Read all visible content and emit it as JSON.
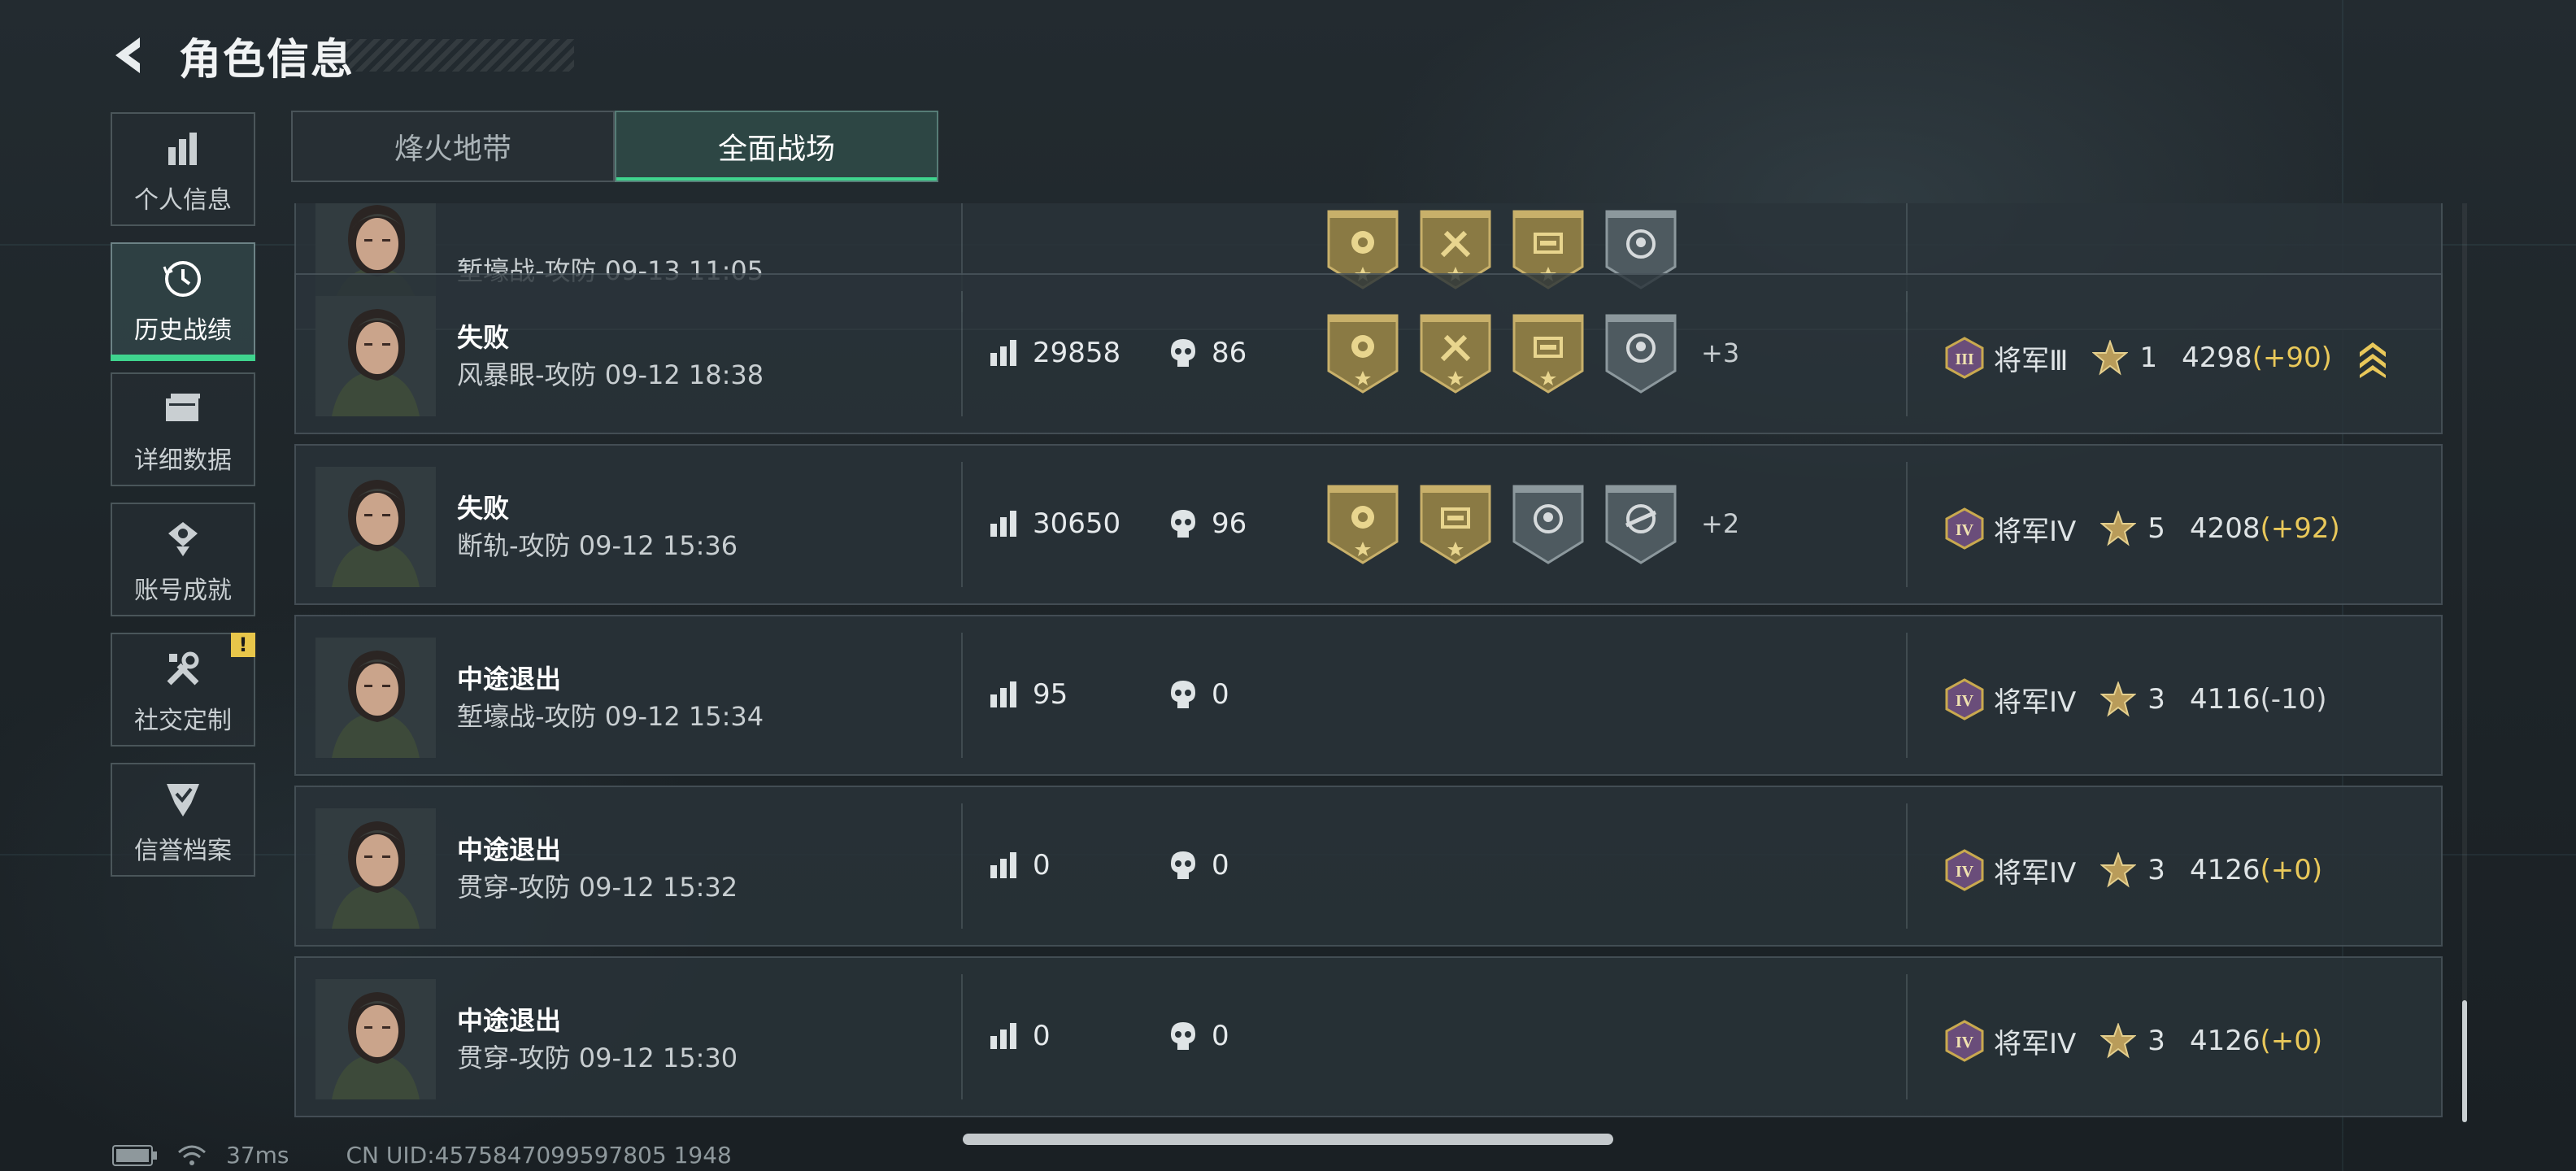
{
  "header": {
    "title": "角色信息"
  },
  "sidebar": {
    "items": [
      {
        "label": "个人信息",
        "icon": "bar-chart-icon",
        "active": false
      },
      {
        "label": "历史战绩",
        "icon": "history-clock-icon",
        "active": true
      },
      {
        "label": "详细数据",
        "icon": "folders-icon",
        "active": false
      },
      {
        "label": "账号成就",
        "icon": "achievement-icon",
        "active": false
      },
      {
        "label": "社交定制",
        "icon": "tools-icon",
        "active": false,
        "badge": "!"
      },
      {
        "label": "信誉档案",
        "icon": "shield-check-icon",
        "active": false
      }
    ]
  },
  "tabs": [
    {
      "label": "烽火地带",
      "active": false
    },
    {
      "label": "全面战场",
      "active": true
    }
  ],
  "matches": [
    {
      "result": "",
      "subtitle": "堑壕战-攻防 09-13 11:05",
      "score": "",
      "kills": "",
      "medals": [
        "gold-rose",
        "gold-axes",
        "gold-ammo",
        "gray-skull"
      ],
      "more": "",
      "rank_roman": "",
      "rank": "",
      "stars": "",
      "rating": "",
      "delta": ""
    },
    {
      "result": "失败",
      "subtitle": "风暴眼-攻防 09-12 18:38",
      "score": "29858",
      "kills": "86",
      "medals": [
        "gold-rose",
        "gold-axes",
        "gold-ammo",
        "gray-skull"
      ],
      "more": "+3",
      "rank_roman": "III",
      "rank": "将军Ⅲ",
      "stars": "1",
      "rating": "4298",
      "delta": "(+90)",
      "delta_positive": true,
      "chevron": true
    },
    {
      "result": "失败",
      "subtitle": "断轨-攻防 09-12 15:36",
      "score": "30650",
      "kills": "96",
      "medals": [
        "gold-rose",
        "gold-ammo",
        "gray-skull",
        "gray-rifle"
      ],
      "more": "+2",
      "rank_roman": "IV",
      "rank": "将军IV",
      "stars": "5",
      "rating": "4208",
      "delta": "(+92)",
      "delta_positive": true,
      "chevron": false
    },
    {
      "result": "中途退出",
      "subtitle": "堑壕战-攻防 09-12 15:34",
      "score": "95",
      "kills": "0",
      "medals": [],
      "more": "",
      "rank_roman": "IV",
      "rank": "将军IV",
      "stars": "3",
      "rating": "4116",
      "delta": "(-10)",
      "delta_positive": false,
      "chevron": false
    },
    {
      "result": "中途退出",
      "subtitle": "贯穿-攻防 09-12 15:32",
      "score": "0",
      "kills": "0",
      "medals": [],
      "more": "",
      "rank_roman": "IV",
      "rank": "将军IV",
      "stars": "3",
      "rating": "4126",
      "delta": "(+0)",
      "delta_positive": true,
      "chevron": false
    },
    {
      "result": "中途退出",
      "subtitle": "贯穿-攻防 09-12 15:30",
      "score": "0",
      "kills": "0",
      "medals": [],
      "more": "",
      "rank_roman": "IV",
      "rank": "将军IV",
      "stars": "3",
      "rating": "4126",
      "delta": "(+0)",
      "delta_positive": true,
      "chevron": false
    }
  ],
  "footer": {
    "ping": "37ms",
    "uid": "CN UID:4575847099597805 1948"
  },
  "colors": {
    "accent": "#3fd48e",
    "gold": "#e9c85a",
    "panel": "#2a3339"
  }
}
